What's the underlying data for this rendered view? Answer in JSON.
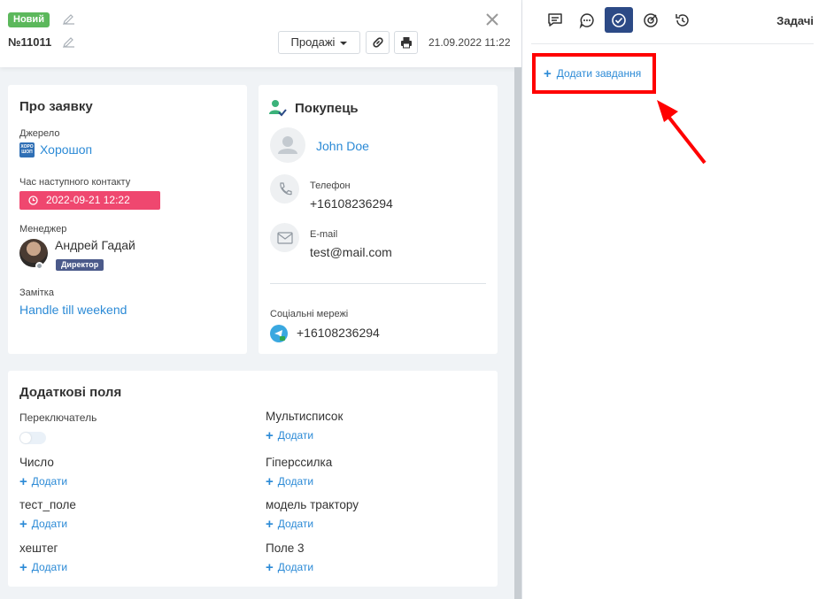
{
  "header": {
    "status_badge": "Новий",
    "order_number": "№11011",
    "status_select": "Продажі",
    "date": "21.09.2022 11:22"
  },
  "about": {
    "title": "Про заявку",
    "source_label": "Джерело",
    "source_logo_text": "ХОРО ШОП",
    "source_value": "Хорошоп",
    "next_contact_label": "Час наступного контакту",
    "next_contact_value": "2022-09-21 12:22",
    "manager_label": "Менеджер",
    "manager_name": "Андрей Гадай",
    "manager_role": "Директор",
    "note_label": "Замітка",
    "note_value": "Handle till weekend"
  },
  "buyer": {
    "title": "Покупець",
    "name": "John Doe",
    "phone_label": "Телефон",
    "phone_value": "+16108236294",
    "email_label": "E-mail",
    "email_value": "test@mail.com",
    "social_label": "Соціальні мережі",
    "social_value": "+16108236294"
  },
  "extra": {
    "title": "Додаткові поля",
    "add_label": "Додати",
    "fields": [
      {
        "label": "Переключатель"
      },
      {
        "label": "Мультисписок"
      },
      {
        "label": "Число"
      },
      {
        "label": "Гіперссилка"
      },
      {
        "label": "тест_поле"
      },
      {
        "label": "модель трактору"
      },
      {
        "label": "хештег"
      },
      {
        "label": "Поле 3"
      }
    ]
  },
  "right": {
    "title": "Задачі",
    "add_task": "Додати завдання",
    "tabs": [
      "comment-icon",
      "chat-icon",
      "check-circle-icon",
      "target-icon",
      "history-icon"
    ]
  },
  "colors": {
    "accent": "#2c4a86",
    "link": "#2b8ad6",
    "status_new": "#5cb85c",
    "date_badge": "#ef476f",
    "highlight": "#ff0000"
  }
}
